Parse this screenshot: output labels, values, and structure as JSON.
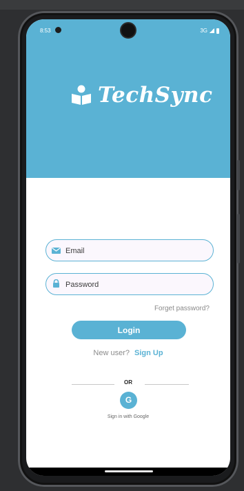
{
  "status_bar": {
    "time": "8:53",
    "network": "3G"
  },
  "brand": {
    "name": "TechSync"
  },
  "form": {
    "email_placeholder": "Email",
    "password_placeholder": "Password",
    "forgot_label": "Forget password?",
    "login_label": "Login",
    "new_user_text": "New user?",
    "sign_up_label": "Sign Up"
  },
  "social": {
    "or_label": "OR",
    "google_letter": "G",
    "google_label": "Sign in with Google"
  },
  "colors": {
    "accent": "#5ab2d4",
    "background": "#ffffff"
  }
}
